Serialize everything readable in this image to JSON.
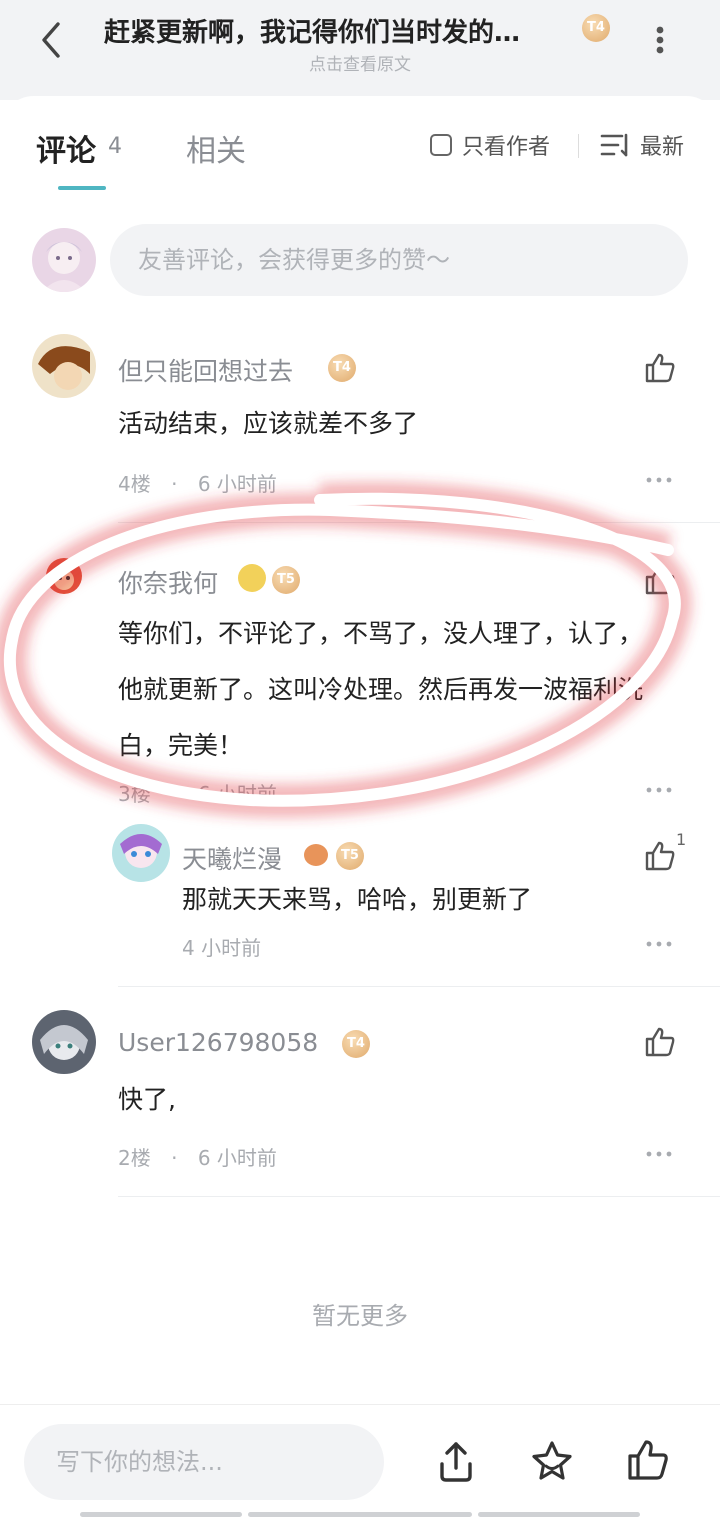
{
  "header": {
    "title": "赶紧更新啊，我记得你们当时发的…",
    "title_badge": "T4",
    "subtitle": "点击查看原文"
  },
  "tabs": {
    "comments_label": "评论",
    "comments_count": "4",
    "related_label": "相关",
    "author_only_label": "只看作者",
    "sort_label": "最新"
  },
  "comment_box": {
    "placeholder": "友善评论，会获得更多的赞～"
  },
  "comments": [
    {
      "user": "但只能回想过去",
      "level": "T4",
      "text": "活动结束，应该就差不多了",
      "floor": "4楼",
      "time": "6 小时前"
    },
    {
      "user": "你奈我何",
      "level": "T5",
      "text": "等你们，不评论了，不骂了，没人理了，认了，他就更新了。这叫冷处理。然后再发一波福利洗白，完美！",
      "floor": "3楼",
      "time": "6 小时前",
      "replies": [
        {
          "user": "天曦烂漫",
          "level": "T5",
          "text": "那就天天来骂，哈哈，别更新了",
          "time": "4 小时前",
          "likes": "1"
        }
      ]
    },
    {
      "user": "User126798058",
      "level": "T4",
      "text": "快了,",
      "floor": "2楼",
      "time": "6 小时前"
    }
  ],
  "meta_separator": "·",
  "no_more": "暂无更多",
  "bottom_bar": {
    "placeholder": "写下你的想法..."
  },
  "icons": {
    "back": "chevron-left-icon",
    "more": "more-vertical-icon",
    "sort": "sort-lines-icon",
    "like": "thumbs-up-icon",
    "share": "share-icon",
    "favorite": "star-icon"
  },
  "colors": {
    "accent": "#4fb6c2",
    "annotation": "#e0303e",
    "badge": "#e0aa6c"
  }
}
